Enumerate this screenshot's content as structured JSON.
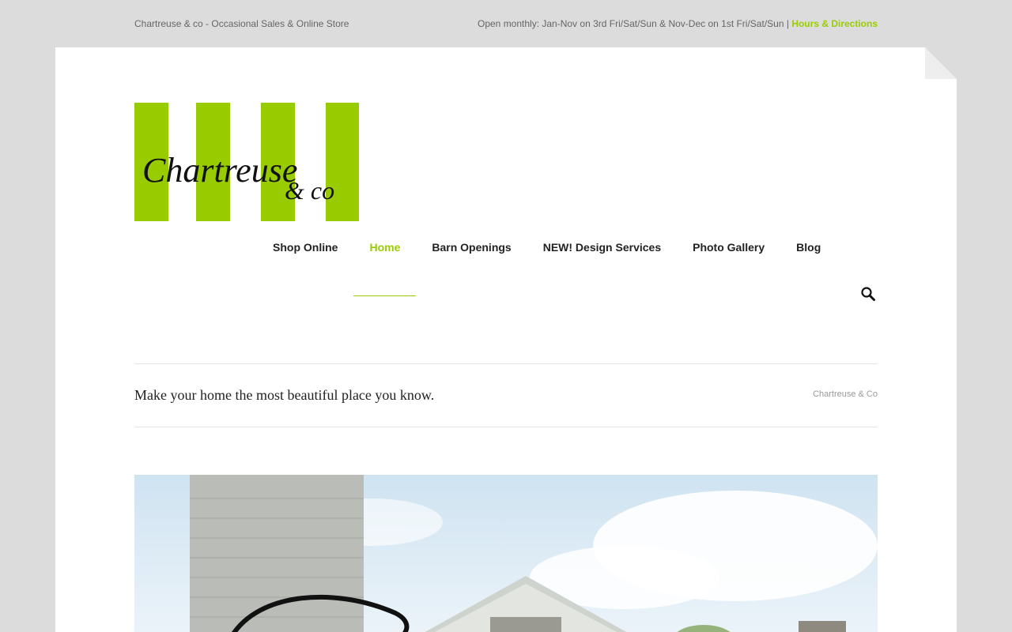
{
  "topbar": {
    "left_text": "Chartreuse & co - Occasional Sales & Online Store",
    "right_text": "Open monthly: Jan-Nov on 3rd Fri/Sat/Sun & Nov-Dec on 1st Fri/Sat/Sun |",
    "link_text": "Hours & Directions"
  },
  "logo": {
    "word1": "Chartreuse",
    "word2": "& co"
  },
  "nav": {
    "items": [
      {
        "label": "Shop Online"
      },
      {
        "label": "Home",
        "active": true
      },
      {
        "label": "Barn Openings"
      },
      {
        "label": "NEW! Design Services"
      },
      {
        "label": "Photo Gallery"
      },
      {
        "label": "Blog"
      }
    ]
  },
  "search": {
    "icon": "search-icon"
  },
  "tagline": {
    "text": "Make your home the most beautiful place you know.",
    "breadcrumb": "Chartreuse & Co"
  },
  "colors": {
    "accent": "#99cc00",
    "background": "#dcdcdc"
  }
}
